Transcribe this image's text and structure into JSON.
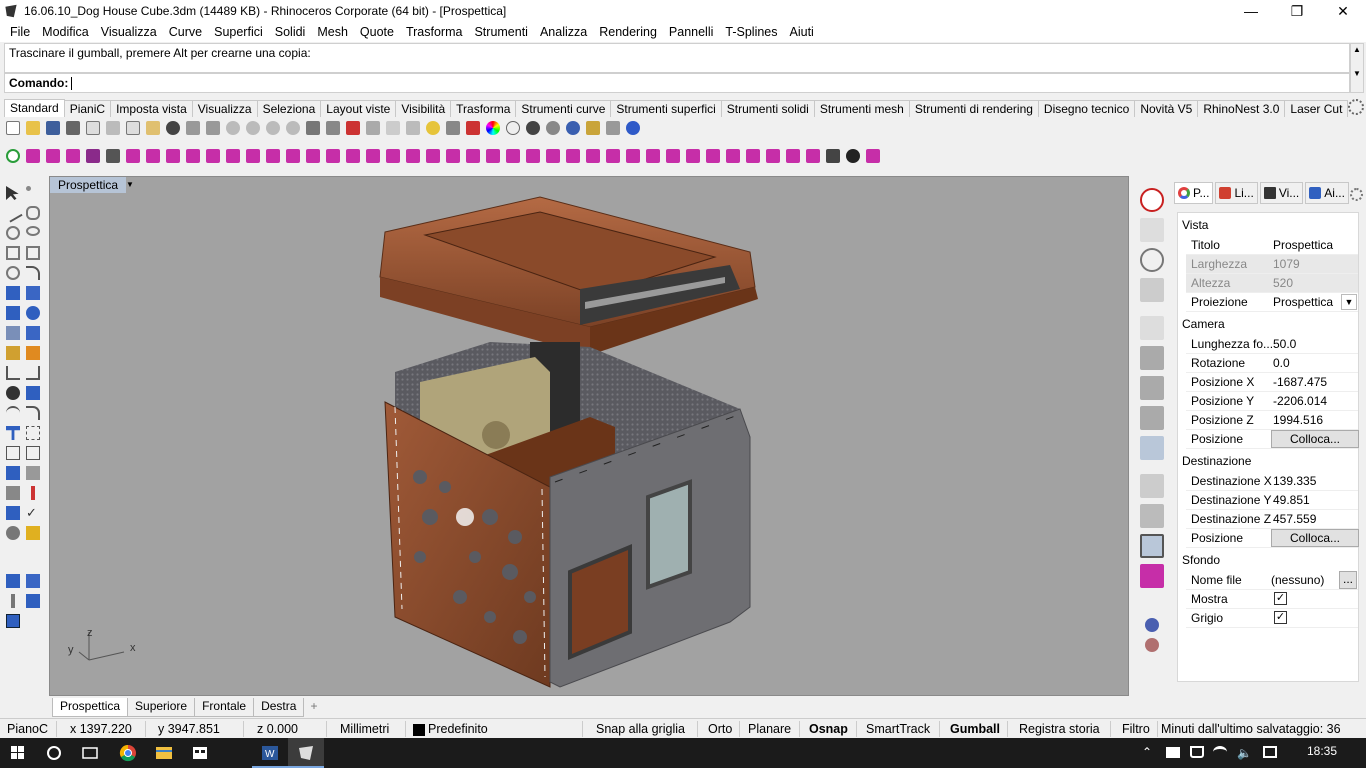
{
  "window": {
    "title": "16.06.10_Dog House Cube.3dm (14489 KB) - Rhinoceros Corporate (64 bit) - [Prospettica]",
    "minimize": "—",
    "restore": "❐",
    "close": "✕"
  },
  "menu": [
    "File",
    "Modifica",
    "Visualizza",
    "Curve",
    "Superfici",
    "Solidi",
    "Mesh",
    "Quote",
    "Trasforma",
    "Strumenti",
    "Analizza",
    "Rendering",
    "Pannelli",
    "T-Splines",
    "Aiuti"
  ],
  "command": {
    "history": "Trascinare il gumball, premere Alt per crearne una copia:",
    "prompt": "Comando:"
  },
  "toolbar_tabs": [
    "Standard",
    "PianiC",
    "Imposta vista",
    "Visualizza",
    "Seleziona",
    "Layout viste",
    "Visibilità",
    "Trasforma",
    "Strumenti curve",
    "Strumenti superfici",
    "Strumenti solidi",
    "Strumenti mesh",
    "Strumenti di rendering",
    "Disegno tecnico",
    "Novità V5",
    "RhinoNest 3.0",
    "Laser Cut"
  ],
  "viewport": {
    "name": "Prospettica",
    "axis_x": "x",
    "axis_y": "y",
    "axis_z": "z"
  },
  "view_tabs": [
    "Prospettica",
    "Superiore",
    "Frontale",
    "Destra"
  ],
  "view_tab_add": "+",
  "properties": {
    "tabs": [
      "P...",
      "Li...",
      "Vi...",
      "Ai..."
    ],
    "sections": {
      "vista": "Vista",
      "camera": "Camera",
      "destinazione": "Destinazione",
      "sfondo": "Sfondo"
    },
    "rows": {
      "titolo": {
        "key": "Titolo",
        "value": "Prospettica"
      },
      "larghezza": {
        "key": "Larghezza",
        "value": "1079"
      },
      "altezza": {
        "key": "Altezza",
        "value": "520"
      },
      "proiezione": {
        "key": "Proiezione",
        "value": "Prospettica"
      },
      "lunghezza": {
        "key": "Lunghezza fo...",
        "value": "50.0"
      },
      "rotazione": {
        "key": "Rotazione",
        "value": "0.0"
      },
      "posx": {
        "key": "Posizione X",
        "value": "-1687.475"
      },
      "posy": {
        "key": "Posizione Y",
        "value": "-2206.014"
      },
      "posz": {
        "key": "Posizione Z",
        "value": "1994.516"
      },
      "posizione_cam": {
        "key": "Posizione",
        "button": "Colloca..."
      },
      "destx": {
        "key": "Destinazione X",
        "value": "139.335"
      },
      "desty": {
        "key": "Destinazione Y",
        "value": "49.851"
      },
      "destz": {
        "key": "Destinazione Z",
        "value": "457.559"
      },
      "posizione_dest": {
        "key": "Posizione",
        "button": "Colloca..."
      },
      "nomefile": {
        "key": "Nome file",
        "value": "(nessuno)",
        "button": "..."
      },
      "mostra": {
        "key": "Mostra",
        "checked": "✓"
      },
      "grigio": {
        "key": "Grigio",
        "checked": "✓"
      }
    }
  },
  "status": {
    "plane": "PianoC",
    "x": "x 1397.220",
    "y": "y 3947.851",
    "z": "z 0.000",
    "units": "Millimetri",
    "layer": "Predefinito",
    "snap": "Snap alla griglia",
    "orto": "Orto",
    "planare": "Planare",
    "osnap": "Osnap",
    "smarttrack": "SmartTrack",
    "gumball": "Gumball",
    "history": "Registra storia",
    "filter": "Filtro",
    "autosave": "Minuti dall'ultimo salvataggio: 36"
  },
  "taskbar": {
    "clock": "18:35"
  },
  "colors": {
    "wood": "#8a4a2c",
    "grey_panel": "#6e6e72",
    "viewport_bg": "#a2a2a2",
    "viewport_label_bg": "#b6c4d6"
  }
}
